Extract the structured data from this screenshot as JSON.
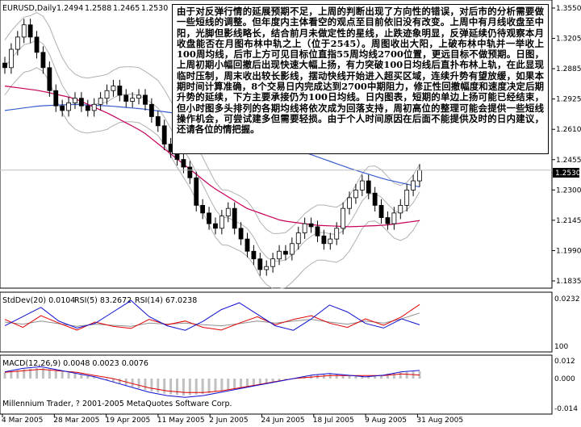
{
  "colors": {
    "background": "#ffffff",
    "candle": "#000000",
    "ma_blue": "#3a5fcd",
    "ma_magenta": "#c8005a",
    "bollinger": "#b0b0b0",
    "price_line": "#c0c0c0",
    "stddev": "#1010d0",
    "rsi5": "#e00000",
    "rsi14": "#909090",
    "macd_hist": "#c0c0c0",
    "macd_signal": "#e00000",
    "macd_line": "#1010d0"
  },
  "header": {
    "symbol": "EURUSD,Daily",
    "open": "1.2494",
    "high": "1.2588",
    "low": "1.2465",
    "close": "1.2530"
  },
  "annotation": {
    "text": "由于对反弹行情的延展预期不足，上周的判断出现了方向性的错误，对后市的分析需要做一些短线的调整。但年度内主体看空的观点至目前依旧没有改变。上周中有月线收盘至中阳，光脚但影线略长，结合前月未做定性的星线，止跌迹象明显，反弹延续仍待观察本月收盘能否在月图布林中轨之上（位于2545）。周图收出大阳，上破布林中轨并一举收上100周均线，后市上方可见目标位直指55周均线2700位置，更远目标不做预期。日图，上周初期小幅回撤后出现快速大幅上扬，有力突破100日均线后直扑布林上轨，在此显现临时压制，周末收出较长影线，摆动快线开始进入超买区域，连续升势有望放缓，如果本期时间计算准确，8个交易日内完成达到2700中期阻力，修正性回撤幅度和速度决定后期升势的延续，下方主要承接仍为100日均线。日内图表，短期的单边上扬可能已经结束，但小时图多头排列的各期均线将依次成为回落支持，周初高位的整理可能会提供一些短线操作机会，可尝试建多但需要轻损。由于个人时间原因在后面不能提供及时的日内建议，还请各位的情把握。"
  },
  "main_chart": {
    "price_scale": [
      "1.3550",
      "1.3205",
      "1.2885",
      "1.2925",
      "1.2610",
      "1.2455",
      "1.2300",
      "1.2145",
      "1.1990",
      "1.1835"
    ],
    "current_price": "1.2530",
    "ylim": [
      1.1785,
      1.36
    ]
  },
  "indicator1": {
    "label_stddev": "StdDev(20) 0.0104",
    "label_rsi5": "RSI(5) 83.2672",
    "label_rsi14": "RSI(14) 67.0238",
    "scale_top": "0.0232",
    "scale_bottom": "100"
  },
  "indicator2": {
    "label": "MACD(12,26,9) 0.0048 0.0023 0.0076",
    "scale": [
      "0.012",
      "0.000",
      "-0.014"
    ]
  },
  "footer": {
    "copyright": "Millennium Trader, ? 2001-2005 MetaQuotes Software Corp."
  },
  "time_axis": [
    "4 Mar 2005",
    "28 Mar 2005",
    "19 Apr 2005",
    "11 May 2005",
    "2 Jun 2005",
    "24 Jun 2005",
    "18 Jul 2005",
    "9 Aug 2005",
    "31 Aug 2005"
  ],
  "chart_data": {
    "type": "candlestick",
    "title": "EURUSD,Daily",
    "ohlc_last": {
      "open": 1.2494,
      "high": 1.2588,
      "low": 1.2465,
      "close": 1.253
    },
    "x": [
      "4 Mar 2005",
      "28 Mar 2005",
      "19 Apr 2005",
      "11 May 2005",
      "2 Jun 2005",
      "24 Jun 2005",
      "18 Jul 2005",
      "9 Aug 2005",
      "31 Aug 2005"
    ],
    "close_path": [
      1.32,
      1.332,
      1.34,
      1.348,
      1.34,
      1.33,
      1.32,
      1.305,
      1.295,
      1.292,
      1.297,
      1.3,
      1.295,
      1.292,
      1.296,
      1.3,
      1.305,
      1.308,
      1.302,
      1.298,
      1.3,
      1.302,
      1.296,
      1.288,
      1.282,
      1.27,
      1.265,
      1.26,
      1.255,
      1.248,
      1.23,
      1.225,
      1.218,
      1.215,
      1.223,
      1.228,
      1.215,
      1.208,
      1.2,
      1.195,
      1.188,
      1.19,
      1.195,
      1.2,
      1.198,
      1.205,
      1.212,
      1.218,
      1.216,
      1.21,
      1.205,
      1.208,
      1.215,
      1.228,
      1.235,
      1.24,
      1.246,
      1.238,
      1.23,
      1.222,
      1.218,
      1.225,
      1.23,
      1.24,
      1.246,
      1.253
    ],
    "ma100_path": [
      1.292,
      1.295,
      1.296,
      1.295,
      1.293,
      1.29,
      1.285,
      1.278,
      1.27,
      1.262,
      1.254,
      1.247,
      1.242
    ],
    "ma_magenta_path": [
      1.308,
      1.305,
      1.3,
      1.29,
      1.278,
      1.26,
      1.242,
      1.228,
      1.22,
      1.217,
      1.216,
      1.217,
      1.22
    ],
    "stddev_path": [
      0.01,
      0.014,
      0.018,
      0.012,
      0.009,
      0.011,
      0.016,
      0.021,
      0.014,
      0.01,
      0.008,
      0.012,
      0.017,
      0.02,
      0.015,
      0.01,
      0.008,
      0.013,
      0.019,
      0.016,
      0.011,
      0.009,
      0.013,
      0.0104
    ],
    "rsi5_path": [
      55,
      40,
      62,
      48,
      35,
      50,
      42,
      38,
      55,
      45,
      52,
      40,
      35,
      48,
      60,
      45,
      55,
      62,
      48,
      40,
      56,
      44,
      60,
      83
    ],
    "rsi14_path": [
      50,
      46,
      52,
      47,
      42,
      46,
      44,
      42,
      48,
      46,
      48,
      45,
      43,
      47,
      52,
      48,
      52,
      55,
      50,
      46,
      52,
      48,
      56,
      67
    ],
    "macd_hist_path": [
      0.004,
      0.006,
      0.007,
      0.005,
      0.003,
      0.001,
      -0.002,
      -0.005,
      -0.008,
      -0.01,
      -0.011,
      -0.01,
      -0.008,
      -0.006,
      -0.004,
      -0.002,
      0.0,
      0.002,
      0.003,
      0.002,
      0.001,
      0.002,
      0.004,
      0.0048
    ],
    "macd_signal_path": [
      0.004,
      0.005,
      0.006,
      0.005,
      0.004,
      0.002,
      0.0,
      -0.003,
      -0.006,
      -0.008,
      -0.009,
      -0.009,
      -0.008,
      -0.006,
      -0.004,
      -0.002,
      0.0,
      0.001,
      0.002,
      0.002,
      0.002,
      0.002,
      0.003,
      0.0023
    ]
  }
}
